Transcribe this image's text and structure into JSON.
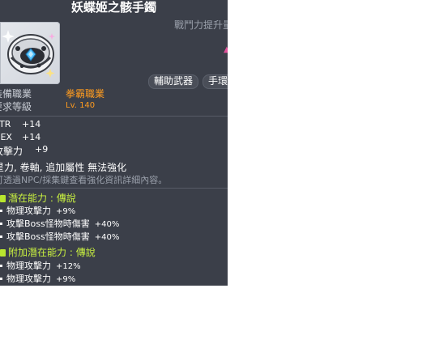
{
  "tooltip": {
    "title": "妖蝶姬之骸手鐲",
    "combat_power_label": "戰鬥力提升量",
    "pink_indicator": "▲",
    "tags": [
      "輔助武器",
      "手環"
    ],
    "requirements": {
      "job_label": "裝備職業",
      "job_value": "拳霸職業",
      "level_label": "要求等級",
      "level_value": "Lv. 140"
    },
    "stats": [
      {
        "name": "STR",
        "value": "+14"
      },
      {
        "name": "DEX",
        "value": "+14"
      },
      {
        "name": "攻擊力",
        "value": "+9"
      }
    ],
    "restriction_text": "星力, 卷軸, 追加屬性 無法強化",
    "hint_text": "可透過NPC/採集鍵查看強化資訊詳細內容。",
    "potential": {
      "label": "潛在能力",
      "separator": " : ",
      "grade": "傳說",
      "lines": [
        {
          "name": "物理攻擊力",
          "value": "+9%"
        },
        {
          "name": "攻擊Boss怪物時傷害",
          "value": "+40%"
        },
        {
          "name": "攻擊Boss怪物時傷害",
          "value": "+40%"
        }
      ]
    },
    "additional_potential": {
      "label": "附加潛在能力",
      "separator": " : ",
      "grade": "傳說",
      "lines": [
        {
          "name": "物理攻擊力",
          "value": "+12%"
        },
        {
          "name": "物理攻擊力",
          "value": "+9%"
        }
      ]
    }
  },
  "colors": {
    "tooltip_bg": "#3b3f49",
    "job_orange": "#ff9b1f",
    "potential_green": "#c8f040"
  },
  "icons": {
    "item": "bracelet-item-icon"
  }
}
